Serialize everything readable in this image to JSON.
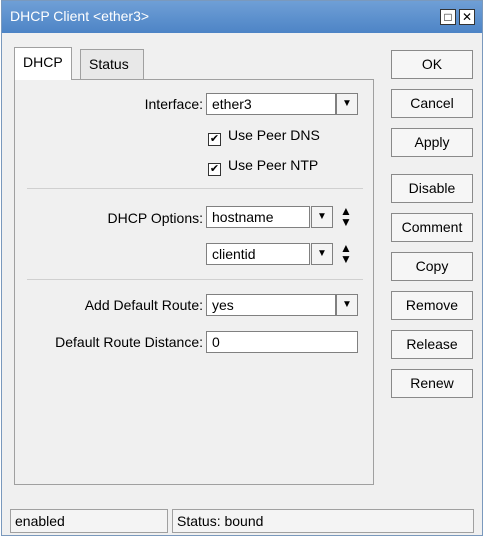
{
  "window": {
    "title": "DHCP Client <ether3>",
    "restore_glyph": "□",
    "close_glyph": "✕"
  },
  "tabs": [
    {
      "label": "DHCP",
      "active": true
    },
    {
      "label": "Status",
      "active": false
    }
  ],
  "form": {
    "interface_label": "Interface:",
    "interface_value": "ether3",
    "use_peer_dns_label": "Use Peer DNS",
    "use_peer_dns_checked": true,
    "use_peer_ntp_label": "Use Peer NTP",
    "use_peer_ntp_checked": true,
    "dhcp_options_label": "DHCP Options:",
    "dhcp_options": [
      "hostname",
      "clientid"
    ],
    "add_default_route_label": "Add Default Route:",
    "add_default_route_value": "yes",
    "default_route_distance_label": "Default Route Distance:",
    "default_route_distance_value": "0"
  },
  "buttons": {
    "ok": "OK",
    "cancel": "Cancel",
    "apply": "Apply",
    "disable": "Disable",
    "comment": "Comment",
    "copy": "Copy",
    "remove": "Remove",
    "release": "Release",
    "renew": "Renew"
  },
  "glyphs": {
    "dropdown": "▼",
    "check": "✔",
    "up": "▲",
    "down": "▼"
  },
  "statusbar": {
    "state": "enabled",
    "status": "Status: bound"
  }
}
